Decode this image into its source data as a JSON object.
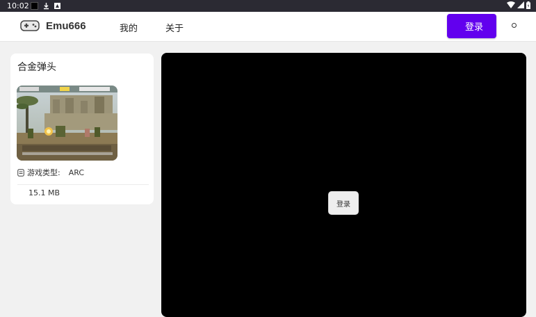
{
  "status_bar": {
    "time": "10:02",
    "icons": [
      "notification-square-icon",
      "download-icon",
      "app-notification-icon",
      "wifi-icon",
      "signal-icon",
      "battery-icon"
    ]
  },
  "header": {
    "brand": "Emu666",
    "nav": [
      {
        "label": "我的"
      },
      {
        "label": "关于"
      }
    ],
    "login_label": "登录",
    "accent_color": "#6200ee"
  },
  "game": {
    "title": "合金弹头",
    "type_label": "游戏类型:",
    "type_value": "ARC",
    "size": "15.1 MB"
  },
  "emulator": {
    "login_label": "登录",
    "background": "#000000"
  }
}
